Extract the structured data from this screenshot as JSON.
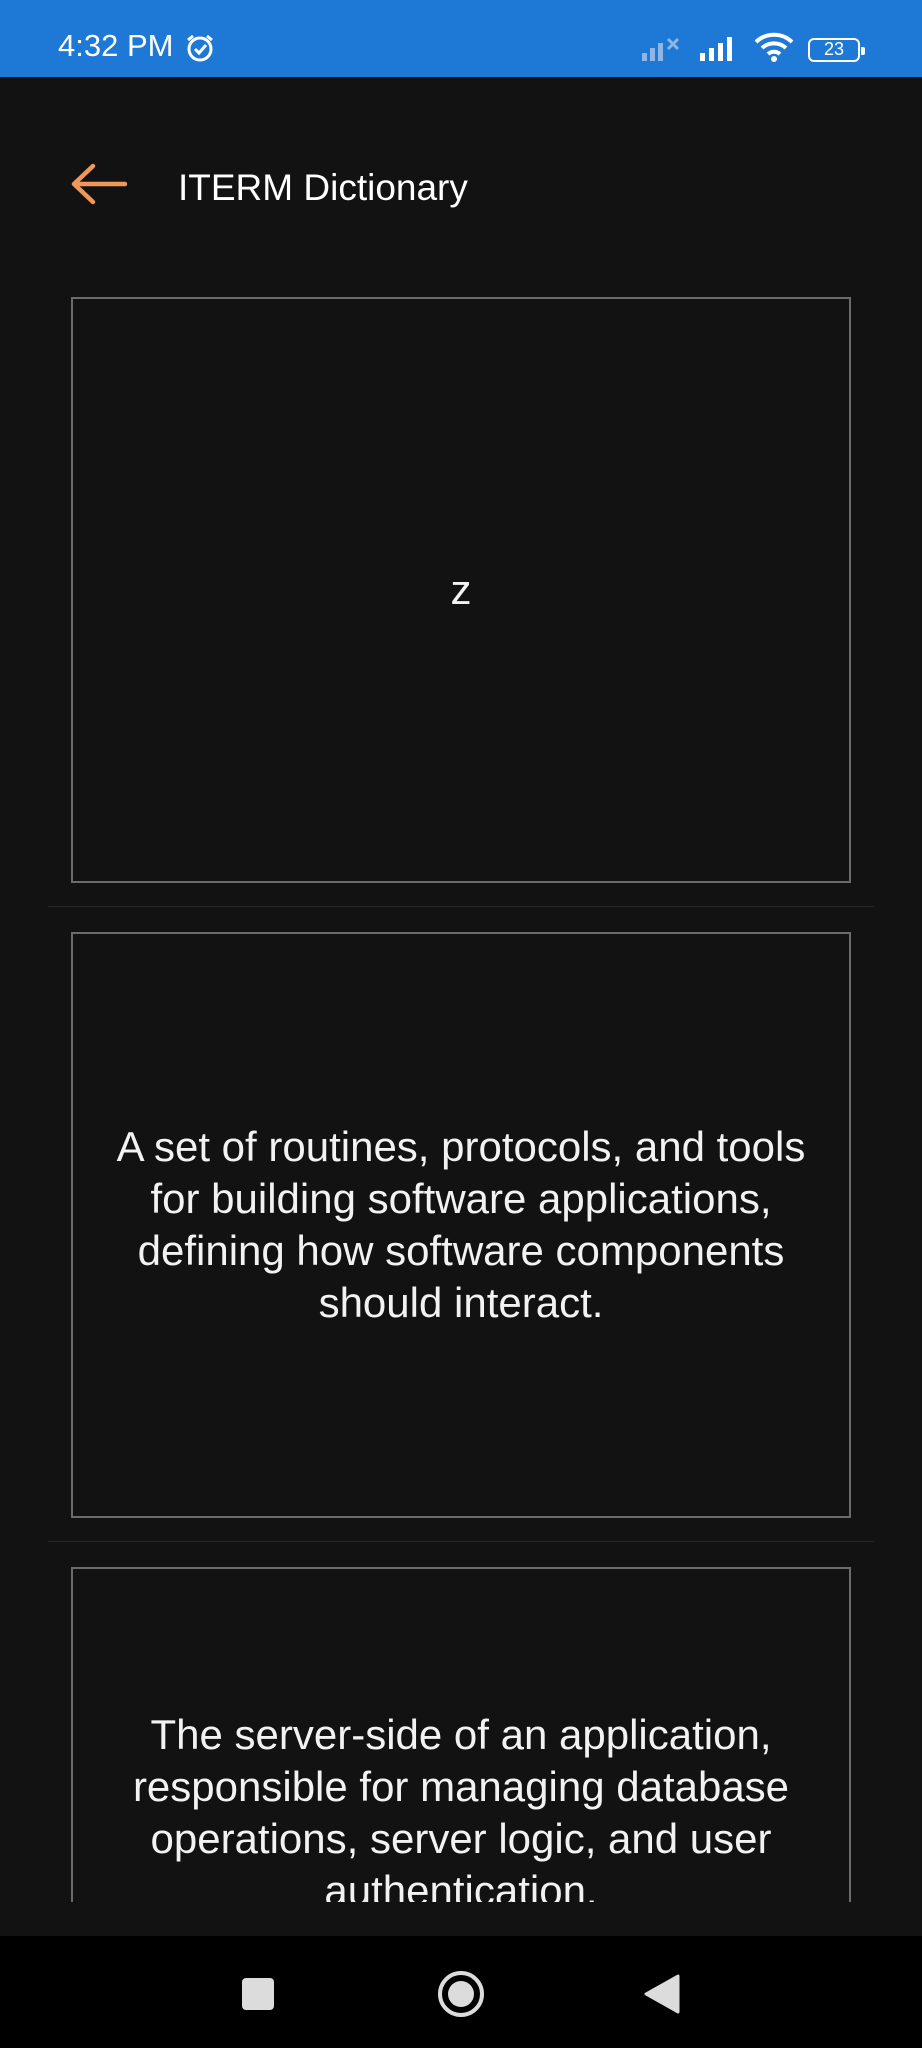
{
  "status_bar": {
    "time": "4:32 PM",
    "battery": "23"
  },
  "header": {
    "title": "ITERM Dictionary"
  },
  "cards": [
    {
      "text": "z"
    },
    {
      "text": "A set of routines, protocols, and tools for building software applications, defining how software components should interact."
    },
    {
      "text": "The server-side of an application, responsible for managing database operations, server logic, and user authentication."
    }
  ],
  "colors": {
    "status_bar": "#1e78d6",
    "background": "#121212",
    "accent": "#f0975a",
    "card_border": "#6b6b6b"
  },
  "icons": {
    "back": "arrow-left-icon",
    "nav_recent": "square-icon",
    "nav_home": "circle-icon",
    "nav_back": "triangle-back-icon"
  }
}
